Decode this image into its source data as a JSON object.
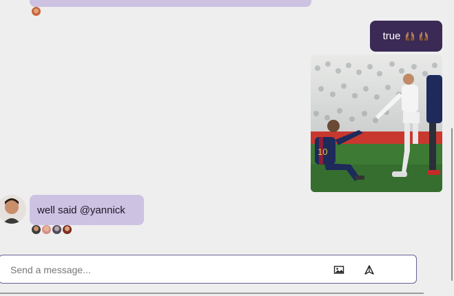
{
  "messages": {
    "outgoing_text": "true",
    "outgoing_emoji": "raised-hands-emoji",
    "incoming_text": "well said @yannick"
  },
  "composer": {
    "placeholder": "Send a message..."
  },
  "colors": {
    "incoming_bubble": "#cdc2e2",
    "outgoing_bubble": "#3b2a55",
    "background": "#efeeef",
    "composer_border": "#6a5d8e"
  },
  "icons": {
    "attach_image": "image-icon",
    "send": "send-icon"
  }
}
